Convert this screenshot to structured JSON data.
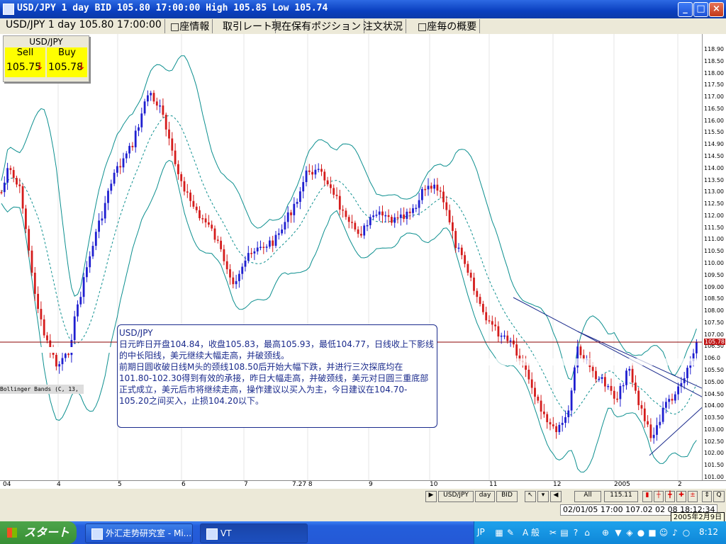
{
  "window": {
    "title": "USD/JPY 1 day BID 105.80 17:00:00 High 105.85 Low 105.74"
  },
  "tabs": [
    {
      "label": "USD/JPY 1 day 105.80 17:00:00"
    },
    {
      "label": "□座情報"
    },
    {
      "label": "取引レート"
    },
    {
      "label": "現在保有ポジション"
    },
    {
      "label": "注文状況"
    },
    {
      "label": "□座毎の概要"
    }
  ],
  "quote": {
    "symbol": "USD/JPY",
    "sell_label": "Sell",
    "buy_label": "Buy",
    "sell_value": "105.75",
    "buy_value": "105.78",
    "arrow": "↓"
  },
  "indicator_label": "Bollinger Bands (C, 13,",
  "comment": {
    "title": "USD/JPY",
    "lines": [
      "日元昨日开盘104.84，收盘105.83，最高105.93，最低104.77，日线收上下影线的中长阳线，美元继续大幅走高，并破颈线。",
      "前期日圆收破日线M头的颈线108.50后开始大幅下跌，并进行三次探底均在101.80-102.30得到有效的承接，昨日大幅走高，并破颈线，美元对日圆三重底部正式成立，美元后市将继续走高，操作建议以买入为主，今日建议在104.70-105.20之间买入，止损104.20以下。"
    ]
  },
  "yaxis_labels": [
    "118.90",
    "118.50",
    "118.00",
    "117.50",
    "117.00",
    "116.50",
    "116.00",
    "115.50",
    "114.90",
    "114.50",
    "114.00",
    "113.50",
    "113.00",
    "112.50",
    "112.00",
    "111.50",
    "111.00",
    "110.50",
    "110.00",
    "109.50",
    "109.00",
    "108.50",
    "108.00",
    "107.50",
    "107.00",
    "106.50",
    "106.0",
    "105.50",
    "105.00",
    "104.50",
    "104.00",
    "103.50",
    "103.00",
    "102.50",
    "102.00",
    "101.50",
    "101.00"
  ],
  "current_price_label": "105.78",
  "xaxis_labels": [
    "04",
    "4",
    "5",
    "6",
    "7",
    "7.27 8",
    "9",
    "10",
    "11",
    "12",
    "2005",
    "2"
  ],
  "toolbar": {
    "symbol_btn": "USD/JPY",
    "period_btn": "day",
    "price_btn": "BID",
    "all_btn": "All",
    "zoom_value": "115.11",
    "nav_arrow": "▶"
  },
  "status": {
    "info": "02/01/05 17:00     107.02  02 08 18:12:34",
    "date": "2005年2月9日"
  },
  "taskbar": {
    "start_label": "スタート",
    "tasks": [
      {
        "label": "外汇走势研究室 - Mi..."
      },
      {
        "label": "VT"
      }
    ],
    "ime": "JP",
    "ime_mode": "A 般",
    "clock": "8:12"
  },
  "colors": {
    "bull": "#1f1fd0",
    "bear": "#d41c1c",
    "band": "#0c8f8f",
    "mid": "#0c8f8f",
    "trend": "#1a2a8c",
    "price_line": "#8b0000"
  }
}
